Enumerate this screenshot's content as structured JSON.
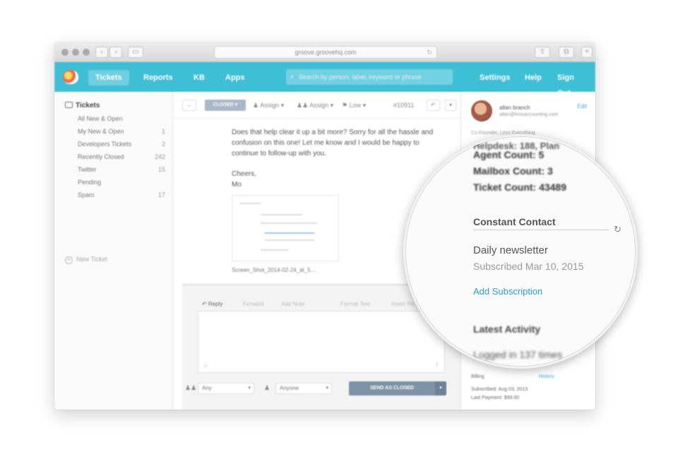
{
  "browser": {
    "url": "groove.groovehq.com"
  },
  "nav": {
    "items": [
      "Tickets",
      "Reports",
      "KB",
      "Apps"
    ],
    "search_placeholder": "Search by person, label, keyword or phrase",
    "right_items": [
      "Settings",
      "Help",
      "Sign Out"
    ]
  },
  "sidebar": {
    "header": "Tickets",
    "items": [
      {
        "label": "All New & Open",
        "count": ""
      },
      {
        "label": "My New & Open",
        "count": "1"
      },
      {
        "label": "Developers Tickets",
        "count": "2"
      },
      {
        "label": "Recently Closed",
        "count": "242"
      },
      {
        "label": "Twitter",
        "count": "15"
      },
      {
        "label": "Pending",
        "count": ""
      },
      {
        "label": "Spam",
        "count": "17"
      }
    ],
    "new_ticket": "New Ticket"
  },
  "toolbar": {
    "back": "←",
    "status": "CLOSED",
    "assign_agent": "Assign",
    "assign_group": "Assign",
    "priority": "Low",
    "ticket_number": "#10911"
  },
  "message": {
    "body": "Does that help clear it up a bit more? Sorry for all the hassle and confusion on this one! Let me know and I would be happy to continue to follow-up with you.",
    "signoff": "Cheers,",
    "signature": "Mo",
    "attachment_name": "Screen_Shot_2014-02-24_at_5...."
  },
  "reply": {
    "tabs": [
      "Reply",
      "Forward",
      "Add Note",
      "Format Text",
      "Insert Re..."
    ],
    "group_select": "Any",
    "agent_select": "Anyone",
    "send_label": "SEND AS CLOSED"
  },
  "customer": {
    "name": "allan branch",
    "email": "allan@lessaccounting.com",
    "edit": "Edit",
    "title": "Co-Founder, Less Everything",
    "billing": "Billing",
    "history": "History",
    "subscribed": "Subscribed: Aug 03, 2013",
    "last_payment": "Last Payment: $99.00"
  },
  "magnified": {
    "line_top": "Helpdesk: 188, Plan",
    "agent_count": "Agent Count: 5",
    "mailbox_count": "Mailbox Count: 3",
    "ticket_count": "Ticket Count: 43489",
    "section_title": "Constant Contact",
    "list_name": "Daily newsletter",
    "subscribed": "Subscribed Mar 10, 2015",
    "add_subscription": "Add Subscription",
    "activity_title": "Latest Activity",
    "activity_line": "Logged in 137 times"
  }
}
